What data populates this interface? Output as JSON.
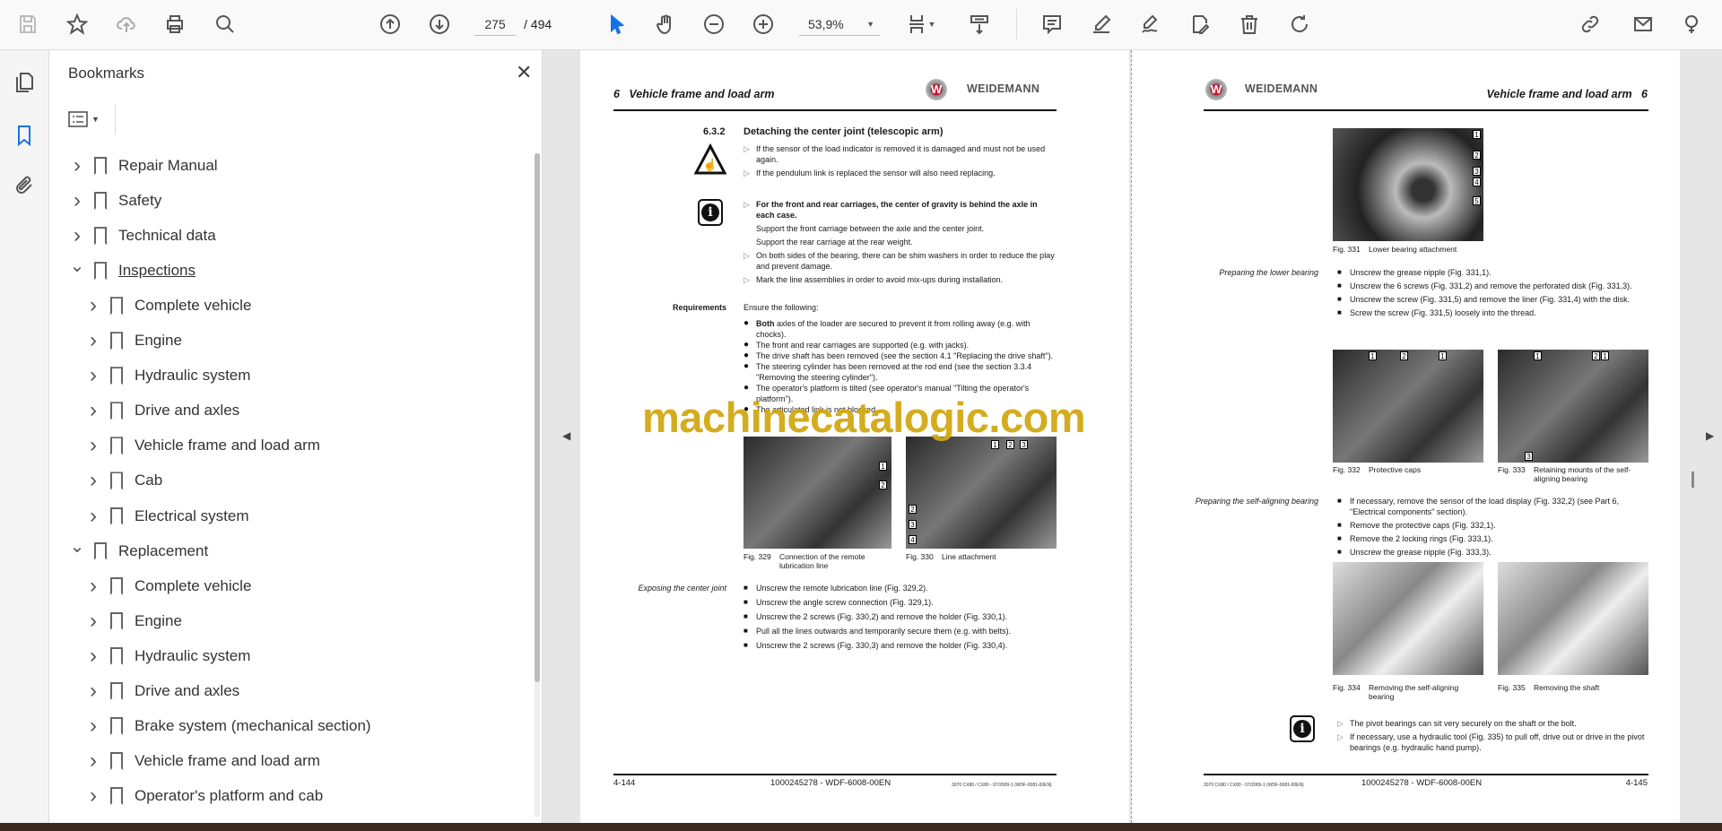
{
  "toolbar": {
    "icons": [
      "save-icon",
      "star-icon",
      "cloud-upload-icon",
      "print-icon",
      "find-icon",
      "page-up-icon",
      "page-down-icon",
      "select-cursor-icon",
      "hand-icon",
      "zoom-out-icon",
      "zoom-in-icon",
      "fit-page-icon",
      "scroll-mode-icon",
      "comment-icon",
      "highlight-pen-icon",
      "sign-icon",
      "edit-text-icon",
      "trash-icon",
      "rotate-icon",
      "share-link-icon",
      "email-icon",
      "account-icon"
    ],
    "page_current": "275",
    "page_total": "/  494",
    "zoom": "53,9%",
    "accent": "#1473e6"
  },
  "sidebar": {
    "title": "Bookmarks",
    "close": "✕",
    "bookmarks": [
      {
        "label": "Repair Manual",
        "level": 0,
        "state": "collapsed"
      },
      {
        "label": "Safety",
        "level": 0,
        "state": "collapsed"
      },
      {
        "label": "Technical data",
        "level": 0,
        "state": "collapsed"
      },
      {
        "label": "Inspections",
        "level": 0,
        "state": "expanded",
        "underline": true
      },
      {
        "label": "Complete vehicle",
        "level": 1,
        "state": "collapsed"
      },
      {
        "label": "Engine",
        "level": 1,
        "state": "collapsed"
      },
      {
        "label": "Hydraulic system",
        "level": 1,
        "state": "collapsed"
      },
      {
        "label": "Drive and axles",
        "level": 1,
        "state": "collapsed"
      },
      {
        "label": "Vehicle frame and load arm",
        "level": 1,
        "state": "collapsed"
      },
      {
        "label": "Cab",
        "level": 1,
        "state": "collapsed"
      },
      {
        "label": "Electrical system",
        "level": 1,
        "state": "collapsed"
      },
      {
        "label": "Replacement",
        "level": 0,
        "state": "expanded"
      },
      {
        "label": "Complete vehicle",
        "level": 1,
        "state": "collapsed"
      },
      {
        "label": "Engine",
        "level": 1,
        "state": "collapsed"
      },
      {
        "label": "Hydraulic system",
        "level": 1,
        "state": "collapsed"
      },
      {
        "label": "Drive and axles",
        "level": 1,
        "state": "collapsed"
      },
      {
        "label": "Brake system (mechanical section)",
        "level": 1,
        "state": "collapsed"
      },
      {
        "label": "Vehicle frame and load arm",
        "level": 1,
        "state": "collapsed"
      },
      {
        "label": "Operator's platform and cab",
        "level": 1,
        "state": "collapsed"
      }
    ]
  },
  "watermark": "machinecatalogic.com",
  "left_page": {
    "chapter_num": "6",
    "chapter": "Vehicle frame and load arm",
    "brand": "WEIDEMANN",
    "section_num": "6.3.2",
    "section_title": "Detaching the center joint (telescopic arm)",
    "warning": [
      "If the sensor of the load indicator is removed it is damaged and must not be used again.",
      "If the pendulum link is replaced the sensor will also need replacing."
    ],
    "info_bold": "For the front and rear carriages, the center of gravity is behind the axle in each case.",
    "info_lines": [
      "Support the front carriage between the axle and the center joint.",
      "Support the rear carriage at the rear weight."
    ],
    "info_more": [
      "On both sides of the bearing, there can be shim washers in order to reduce the play and prevent damage.",
      "Mark the line assemblies in order to avoid mix-ups during installation."
    ],
    "req_label": "Requirements",
    "req_intro": "Ensure the following:",
    "req_first_bold": "Both",
    "requirements": [
      " axles of the loader are secured to prevent it from rolling away (e.g. with chocks).",
      "The front and rear carriages are supported (e.g. with jacks).",
      "The drive shaft has been removed (see the section 4.1 \"Replacing the drive shaft\").",
      "The steering cylinder has been removed at the rod end (see the section 3.3.4 \"Removing the steering cylinder\").",
      "The operator's platform is tilted (see operator's manual \"Tilting the operator's platform\").",
      "The articulated link is not blocked."
    ],
    "fig329": {
      "num": "Fig. 329",
      "caption": "Connection of the remote lubrication line"
    },
    "fig330": {
      "num": "Fig. 330",
      "caption": "Line attachment"
    },
    "expose_label": "Exposing the center joint",
    "expose_steps": [
      "Unscrew the remote lubrication line (Fig. 329,2).",
      "Unscrew the angle screw connection (Fig. 329,1).",
      "Unscrew the 2 screws (Fig. 330,2) and remove the holder (Fig. 330,1).",
      "Pull all the lines outwards and temporarily secure them (e.g. with belts).",
      "Unscrew the 2 screws (Fig. 330,3) and remove the holder (Fig. 330,4)."
    ],
    "page_no": "4-144",
    "doc_no": "1000245278 - WDF-6008-00EN",
    "small": "3070 CX80 / CX80 - 07/2009-1 (WDF-0081-00EN)"
  },
  "right_page": {
    "chapter_num": "6",
    "chapter": "Vehicle frame and load arm",
    "brand": "WEIDEMANN",
    "fig331": {
      "num": "Fig. 331",
      "caption": "Lower bearing attachment"
    },
    "lower_label": "Preparing the lower bearing",
    "lower_steps": [
      "Unscrew the grease nipple (Fig. 331,1).",
      "Unscrew the 6 screws (Fig. 331,2) and remove the perforated disk (Fig. 331,3).",
      "Unscrew the screw (Fig. 331,5) and remove the liner (Fig. 331,4) with the disk.",
      "Screw the screw (Fig. 331,5) loosely into the thread."
    ],
    "fig332": {
      "num": "Fig. 332",
      "caption": "Protective caps"
    },
    "fig333": {
      "num": "Fig. 333",
      "caption": "Retaining mounts of the self-aligning bearing"
    },
    "self_label": "Preparing the self-aligning bearing",
    "self_steps": [
      "If necessary, remove the sensor of the load display (Fig. 332,2) (see Part 6, \"Electrical components\" section).",
      "Remove the protective caps (Fig. 332,1).",
      "Remove the 2 locking rings (Fig. 333,1).",
      "Unscrew the grease nipple (Fig. 333,3)."
    ],
    "fig334": {
      "num": "Fig. 334",
      "caption": "Removing the self-aligning bearing"
    },
    "fig335": {
      "num": "Fig. 335",
      "caption": "Removing the shaft"
    },
    "info": [
      "The pivot bearings can sit very securely on the shaft or the bolt.",
      "If necessary, use a hydraulic tool (Fig. 335) to pull off, drive out or drive in the pivot bearings (e.g. hydraulic hand pump)."
    ],
    "page_no": "4-145",
    "doc_no": "1000245278 - WDF-6008-00EN",
    "small": "3070 CX80 / CX80 - 07/2009-1 (WDF-0081-00EN)"
  },
  "callouts": {
    "n1": "1",
    "n2": "2",
    "n3": "3",
    "n4": "4",
    "n5": "5"
  }
}
